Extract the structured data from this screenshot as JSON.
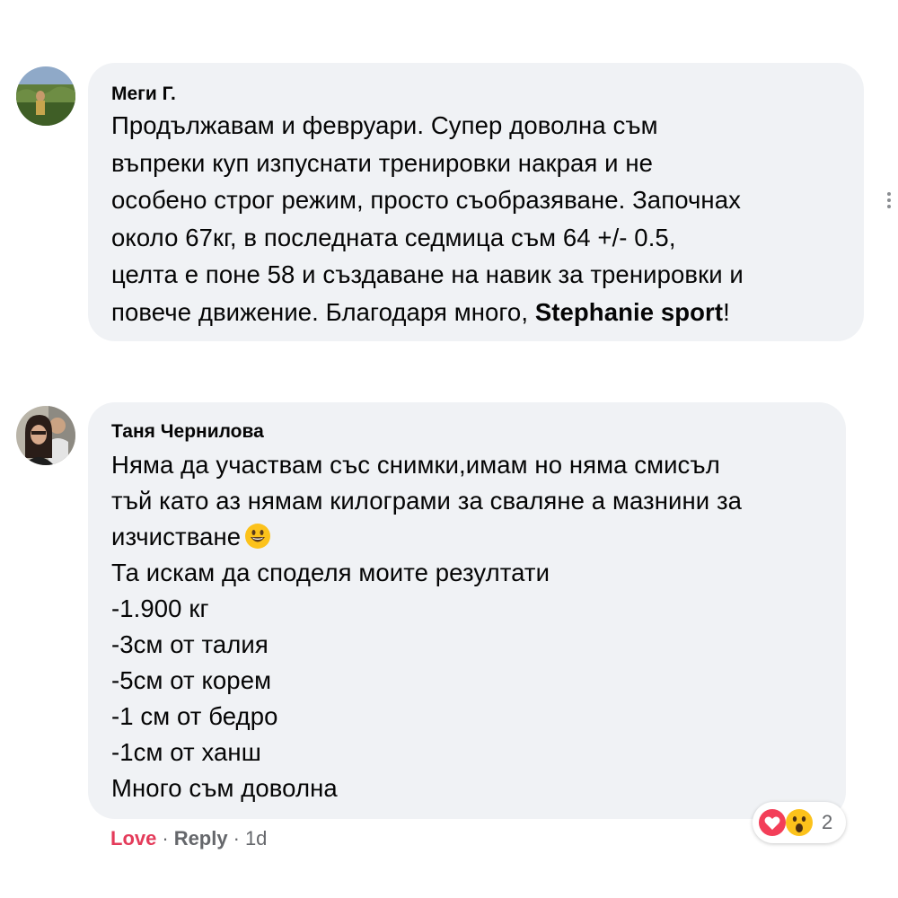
{
  "comments": [
    {
      "author": "Меги Г.",
      "lines": [
        "Продължавам и февруари. Супер доволна съм",
        "въпреки куп изпуснати тренировки накрая и не",
        "особено строг режим, просто съобразяване. Започнах",
        "около 67кг, в последната седмица съм 64 +/- 0.5,",
        "целта е поне 58 и създаване на навик за тренировки и",
        "повече движение. Благодаря много, "
      ],
      "mention": "Stephanie sport",
      "after_mention": "!"
    },
    {
      "author": "Таня Чернилова",
      "lines": [
        "Няма да участвам със снимки,имам но няма смисъл",
        "тъй като аз нямам килограми за сваляне а мазнини за",
        "изчистване",
        "Та искам да споделя моите резултати",
        "-1.900 кг",
        "-3см от талия",
        "-5см от корем",
        "-1 см от бедро",
        "-1см от ханш",
        "Много съм доволна"
      ],
      "inline_emoji": "grinning-face-emoji",
      "actions": {
        "love": "Love",
        "reply": "Reply",
        "separator": "·",
        "time": "1d"
      },
      "reactions": {
        "icons": [
          "heart-reaction-icon",
          "wow-reaction-icon"
        ],
        "count": "2"
      }
    }
  ],
  "colors": {
    "bubble": "#f0f2f5",
    "text": "#050505",
    "secondary": "#65676b",
    "love": "#e43b5a"
  }
}
